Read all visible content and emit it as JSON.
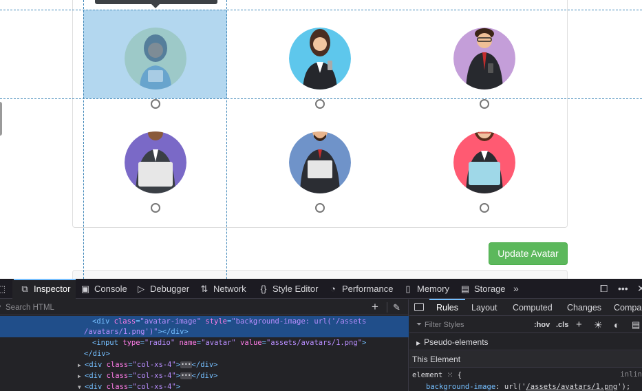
{
  "page": {
    "update_button_label": "Update Avatar"
  },
  "avatars": [
    {
      "value": "assets/avatars/1.png",
      "selected": false
    },
    {
      "value": "assets/avatars/2.png",
      "selected": false
    },
    {
      "value": "assets/avatars/3.png",
      "selected": false
    },
    {
      "value": "assets/avatars/4.png",
      "selected": false
    },
    {
      "value": "assets/avatars/5.png",
      "selected": false
    },
    {
      "value": "assets/avatars/6.png",
      "selected": false
    }
  ],
  "devtools": {
    "tabs": [
      {
        "label": "Inspector",
        "icon": "inspector-icon",
        "active": true
      },
      {
        "label": "Console",
        "icon": "console-icon"
      },
      {
        "label": "Debugger",
        "icon": "debugger-icon"
      },
      {
        "label": "Network",
        "icon": "network-icon"
      },
      {
        "label": "Style Editor",
        "icon": "braces-icon"
      },
      {
        "label": "Performance",
        "icon": "gauge-icon"
      },
      {
        "label": "Memory",
        "icon": "chip-icon"
      },
      {
        "label": "Storage",
        "icon": "database-icon"
      }
    ],
    "search_placeholder": "Search HTML",
    "markup": {
      "selected_line_1": "<div class=\"avatar-image\" style=\"background-image: url('/assets",
      "selected_line_2": "/avatars/1.png')\"></div>",
      "input_line": "<input type=\"radio\" name=\"avatar\" value=\"assets/avatars/1.png\">",
      "close_div": "</div>",
      "collapsed_div": "<div class=\"col-xs-4\">",
      "expanded_div": "<div class=\"col-xs-4\">"
    },
    "rules_tabs": [
      "Rules",
      "Layout",
      "Computed",
      "Changes",
      "Compa"
    ],
    "filter_placeholder": "Filter Styles",
    "filter_tools": {
      "hov": ":hov",
      "cls": ".cls"
    },
    "pseudo_elements_label": "Pseudo-elements",
    "this_element_label": "This Element",
    "element_rule": "element",
    "inline_label": "inlin",
    "rule_property": "background-image",
    "rule_value_prefix": "url('",
    "rule_value_url": "/assets/avatars/1.png",
    "rule_value_suffix": "');"
  },
  "colors": {
    "accent": "#5cb85c",
    "highlight": "#74b6e2",
    "devtools_bg": "#232327",
    "selection": "#204e8a"
  }
}
